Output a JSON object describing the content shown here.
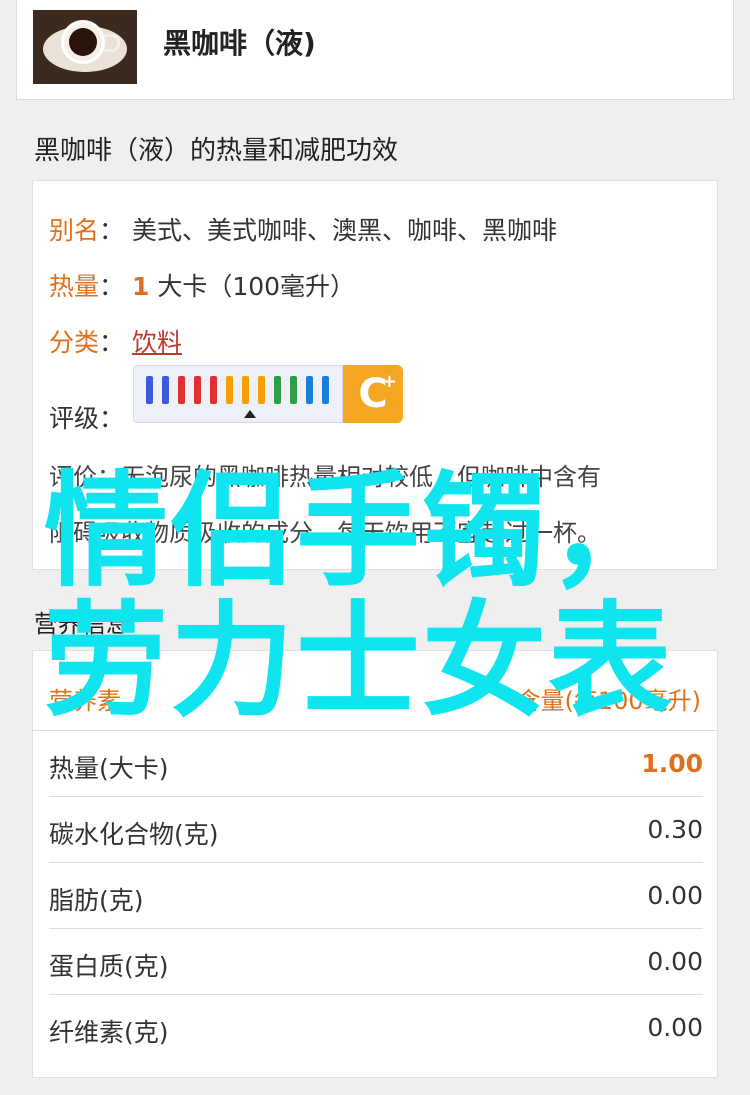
{
  "product": {
    "name": "黑咖啡（液)",
    "thumbnail_icon": "coffee-cup-image"
  },
  "section_heat_title": "黑咖啡（液）的热量和减肥功效",
  "info": {
    "alias_key": "别名",
    "alias_value": "美式、美式咖啡、澳黑、咖啡、黑咖啡",
    "calorie_key": "热量",
    "calorie_num": "1",
    "calorie_unit": "大卡（100毫升）",
    "category_key": "分类",
    "category_value": "饮料",
    "grade_key": "评级",
    "grade_value": "C",
    "grade_plus": "+",
    "desc_line1": "评价：无泡尿的黑咖啡热量相对较低，但咖啡中含有",
    "desc_line2": "阻碍吸收物质吸收的成分，每天饮用不宜超过一杯。"
  },
  "section_nutri_title": "营养信息",
  "nutrition": {
    "col_name": "营养素",
    "col_value": "含量(每100毫升)",
    "rows": [
      {
        "name": "热量(大卡)",
        "value": "1.00"
      },
      {
        "name": "碳水化合物(克)",
        "value": "0.30"
      },
      {
        "name": "脂肪(克)",
        "value": "0.00"
      },
      {
        "name": "蛋白质(克)",
        "value": "0.00"
      },
      {
        "name": "纤维素(克)",
        "value": "0.00"
      }
    ]
  },
  "overlay": {
    "line1": "情侣手镯，",
    "line2": "劳力士女表"
  },
  "gauge_colors": [
    "#3b5bdb",
    "#3b5bdb",
    "#e03131",
    "#e03131",
    "#e03131",
    "#f59f00",
    "#f59f00",
    "#f59f00",
    "#2f9e44",
    "#2f9e44",
    "#1c7ed6",
    "#1c7ed6"
  ],
  "accent_color": "#e0711c",
  "overlay_color": "#10e4ee"
}
